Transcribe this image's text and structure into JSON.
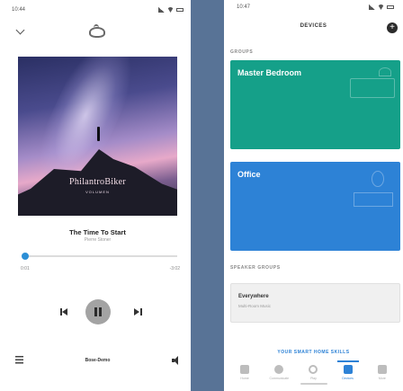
{
  "player": {
    "status_time": "10:44",
    "album_art_title": "PhilantroBiker",
    "album_art_subtitle": "VOLUMEN",
    "song_title": "The Time To Start",
    "song_artist": "Pierre Stoner",
    "time_elapsed": "0:01",
    "time_remaining": "-3:02",
    "progress_fraction": 0.02,
    "device_label": "Bose-Demo"
  },
  "devices": {
    "status_time": "10:47",
    "header_title": "DEVICES",
    "groups_label": "GROUPS",
    "groups": [
      {
        "name": "Master Bedroom",
        "color": "#15a089"
      },
      {
        "name": "Office",
        "color": "#2d82d6"
      }
    ],
    "speaker_groups_label": "SPEAKER GROUPS",
    "speaker_group": {
      "name": "Everywhere",
      "sub": "Multi-Room Music"
    },
    "skills_link": "YOUR SMART HOME SKILLS",
    "nav": [
      {
        "label": "Home",
        "icon": "home-icon"
      },
      {
        "label": "Communicate",
        "icon": "chat-bubble-icon"
      },
      {
        "label": "Play",
        "icon": "play-icon"
      },
      {
        "label": "Devices",
        "icon": "devices-icon"
      },
      {
        "label": "More",
        "icon": "menu-icon"
      }
    ]
  },
  "colors": {
    "accent": "#2d82d6",
    "teal": "#15a089",
    "divider": "#587396"
  }
}
